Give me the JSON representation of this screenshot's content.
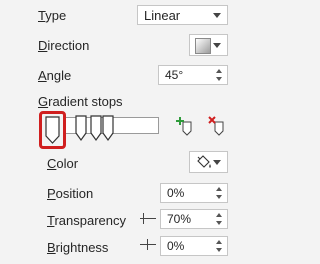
{
  "type": {
    "label": "Type",
    "value": "Linear"
  },
  "direction": {
    "label": "Direction"
  },
  "angle": {
    "label": "Angle",
    "value": "45°"
  },
  "gradient_stops": {
    "label": "Gradient stops",
    "add_stop_icon": "add-gradient-stop-icon",
    "remove_stop_icon": "remove-gradient-stop-icon"
  },
  "color": {
    "label": "Color",
    "icon": "paint-bucket-icon"
  },
  "position": {
    "label": "Position",
    "value": "0%"
  },
  "transparency": {
    "label": "Transparency",
    "value": "70%"
  },
  "brightness": {
    "label": "Brightness",
    "value": "0%"
  },
  "colors": {
    "selection_border": "#d01f1f",
    "panel_bg": "#f3f3f3"
  }
}
